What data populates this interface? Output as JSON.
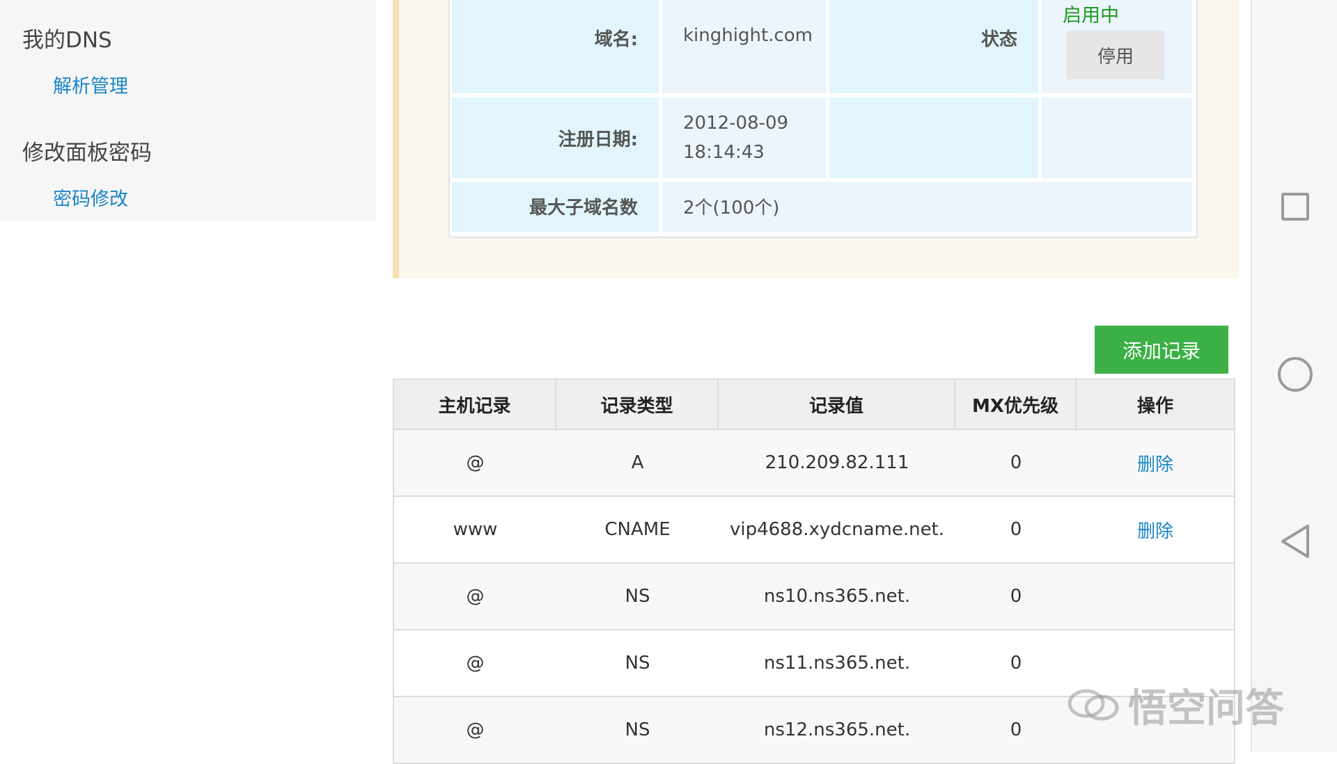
{
  "sidebar": {
    "groups": [
      {
        "title": "我的DNS",
        "link": "解析管理"
      },
      {
        "title": "修改面板密码",
        "link": "密码修改"
      }
    ]
  },
  "domain_info": {
    "domain_label": "域名:",
    "domain_value": "kinghight.com",
    "status_label": "状态",
    "status_value": "启用中",
    "disable_button": "停用",
    "reg_date_label": "注册日期:",
    "reg_date": "2012-08-09",
    "reg_time": "18:14:43",
    "max_sub_label": "最大子域名数",
    "max_sub_value": "2个(100个)"
  },
  "add_record_button": "添加记录",
  "records": {
    "headers": [
      "主机记录",
      "记录类型",
      "记录值",
      "MX优先级",
      "操作"
    ],
    "rows": [
      {
        "host": "@",
        "type": "A",
        "value": "210.209.82.111",
        "mx": "0",
        "action": "删除"
      },
      {
        "host": "www",
        "type": "CNAME",
        "value": "vip4688.xydcname.net.",
        "mx": "0",
        "action": "删除"
      },
      {
        "host": "@",
        "type": "NS",
        "value": "ns10.ns365.net.",
        "mx": "0",
        "action": ""
      },
      {
        "host": "@",
        "type": "NS",
        "value": "ns11.ns365.net.",
        "mx": "0",
        "action": ""
      },
      {
        "host": "@",
        "type": "NS",
        "value": "ns12.ns365.net.",
        "mx": "0",
        "action": ""
      }
    ]
  },
  "navbar": {
    "icons": [
      "recent-apps-icon",
      "home-icon",
      "back-icon"
    ]
  },
  "watermark": "悟空问答",
  "colors": {
    "accent_green": "#3cb046",
    "link_blue": "#1a86c8",
    "status_green": "#1c9a1c"
  }
}
